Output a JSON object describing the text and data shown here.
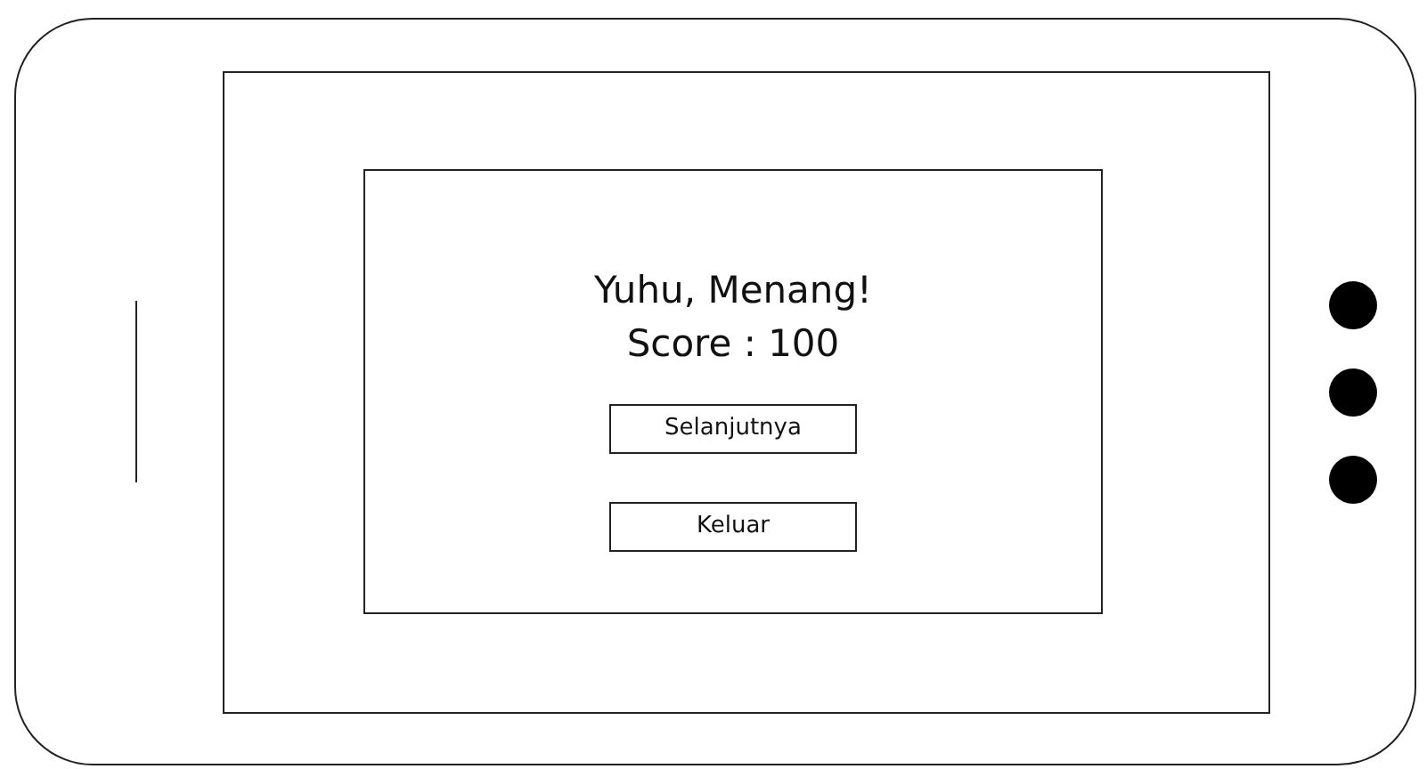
{
  "dialog": {
    "title": "Yuhu, Menang!",
    "score": "Score : 100",
    "buttons": [
      {
        "label": "Selanjutnya"
      },
      {
        "label": "Keluar"
      }
    ]
  }
}
